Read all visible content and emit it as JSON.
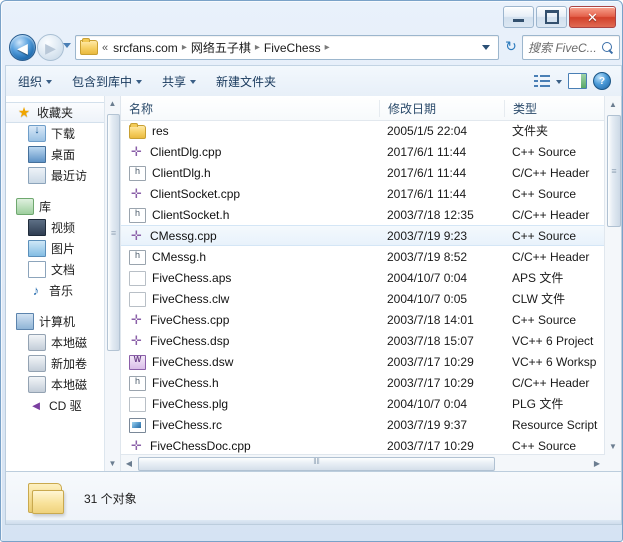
{
  "window": {
    "controls": {
      "minimize": "—",
      "maximize": "□",
      "close": "✕"
    }
  },
  "address_bar": {
    "back_glyph": "◀",
    "forward_glyph": "▶",
    "ellipsis": "«",
    "crumbs": [
      "srcfans.com",
      "网络五子棋",
      "FiveChess"
    ],
    "separator": "▸",
    "refresh_glyph": "↻"
  },
  "search": {
    "placeholder": "搜索 FiveC...",
    "icon": "search-icon"
  },
  "toolbar": {
    "organize": "组织",
    "include_in_library": "包含到库中",
    "share": "共享",
    "new_folder": "新建文件夹",
    "help_glyph": "?"
  },
  "sidebar": {
    "groups": [
      {
        "header": "收藏夹",
        "header_icon": "star-icon",
        "items": [
          {
            "label": "下载",
            "icon": "download-icon"
          },
          {
            "label": "桌面",
            "icon": "desktop-icon"
          },
          {
            "label": "最近访",
            "icon": "recent-places-icon"
          }
        ]
      },
      {
        "header": "库",
        "header_icon": "library-icon",
        "items": [
          {
            "label": "视频",
            "icon": "video-icon"
          },
          {
            "label": "图片",
            "icon": "pictures-icon"
          },
          {
            "label": "文档",
            "icon": "documents-icon"
          },
          {
            "label": "音乐",
            "icon": "music-icon"
          }
        ]
      },
      {
        "header": "计算机",
        "header_icon": "computer-icon",
        "items": [
          {
            "label": "本地磁",
            "icon": "local-disk-icon"
          },
          {
            "label": "新加卷",
            "icon": "drive-icon"
          },
          {
            "label": "本地磁",
            "icon": "drive-icon"
          },
          {
            "label": "CD 驱",
            "icon": "cd-drive-icon"
          }
        ]
      }
    ],
    "scroll_up_glyph": "▲",
    "scroll_down_glyph": "▼"
  },
  "file_list": {
    "columns": [
      "名称",
      "修改日期",
      "类型"
    ],
    "rows": [
      {
        "name": "res",
        "date": "2005/1/5 22:04",
        "type": "文件夹",
        "icon": "folder-icon",
        "selected": false
      },
      {
        "name": "ClientDlg.cpp",
        "date": "2017/6/1 11:44",
        "type": "C++ Source",
        "icon": "cpp-file-icon",
        "selected": false
      },
      {
        "name": "ClientDlg.h",
        "date": "2017/6/1 11:44",
        "type": "C/C++ Header",
        "icon": "header-file-icon",
        "selected": false
      },
      {
        "name": "ClientSocket.cpp",
        "date": "2017/6/1 11:44",
        "type": "C++ Source",
        "icon": "cpp-file-icon",
        "selected": false
      },
      {
        "name": "ClientSocket.h",
        "date": "2003/7/18 12:35",
        "type": "C/C++ Header",
        "icon": "header-file-icon",
        "selected": false
      },
      {
        "name": "CMessg.cpp",
        "date": "2003/7/19 9:23",
        "type": "C++ Source",
        "icon": "cpp-file-icon",
        "selected": true
      },
      {
        "name": "CMessg.h",
        "date": "2003/7/19 8:52",
        "type": "C/C++ Header",
        "icon": "header-file-icon",
        "selected": false
      },
      {
        "name": "FiveChess.aps",
        "date": "2004/10/7 0:04",
        "type": "APS 文件",
        "icon": "generic-file-icon",
        "selected": false
      },
      {
        "name": "FiveChess.clw",
        "date": "2004/10/7 0:05",
        "type": "CLW 文件",
        "icon": "generic-file-icon",
        "selected": false
      },
      {
        "name": "FiveChess.cpp",
        "date": "2003/7/18 14:01",
        "type": "C++ Source",
        "icon": "cpp-file-icon",
        "selected": false
      },
      {
        "name": "FiveChess.dsp",
        "date": "2003/7/18 15:07",
        "type": "VC++ 6 Project",
        "icon": "cpp-file-icon",
        "selected": false
      },
      {
        "name": "FiveChess.dsw",
        "date": "2003/7/17 10:29",
        "type": "VC++ 6 Worksp",
        "icon": "workspace-icon",
        "selected": false
      },
      {
        "name": "FiveChess.h",
        "date": "2003/7/17 10:29",
        "type": "C/C++ Header",
        "icon": "header-file-icon",
        "selected": false
      },
      {
        "name": "FiveChess.plg",
        "date": "2004/10/7 0:04",
        "type": "PLG 文件",
        "icon": "generic-file-icon",
        "selected": false
      },
      {
        "name": "FiveChess.rc",
        "date": "2003/7/19 9:37",
        "type": "Resource Script",
        "icon": "resource-icon",
        "selected": false
      },
      {
        "name": "FiveChessDoc.cpp",
        "date": "2003/7/17 10:29",
        "type": "C++ Source",
        "icon": "cpp-file-icon",
        "selected": false
      }
    ],
    "scroll_up_glyph": "▲",
    "scroll_down_glyph": "▼",
    "scroll_left_glyph": "◀",
    "scroll_right_glyph": "▶"
  },
  "status_bar": {
    "text": "31 个对象"
  }
}
